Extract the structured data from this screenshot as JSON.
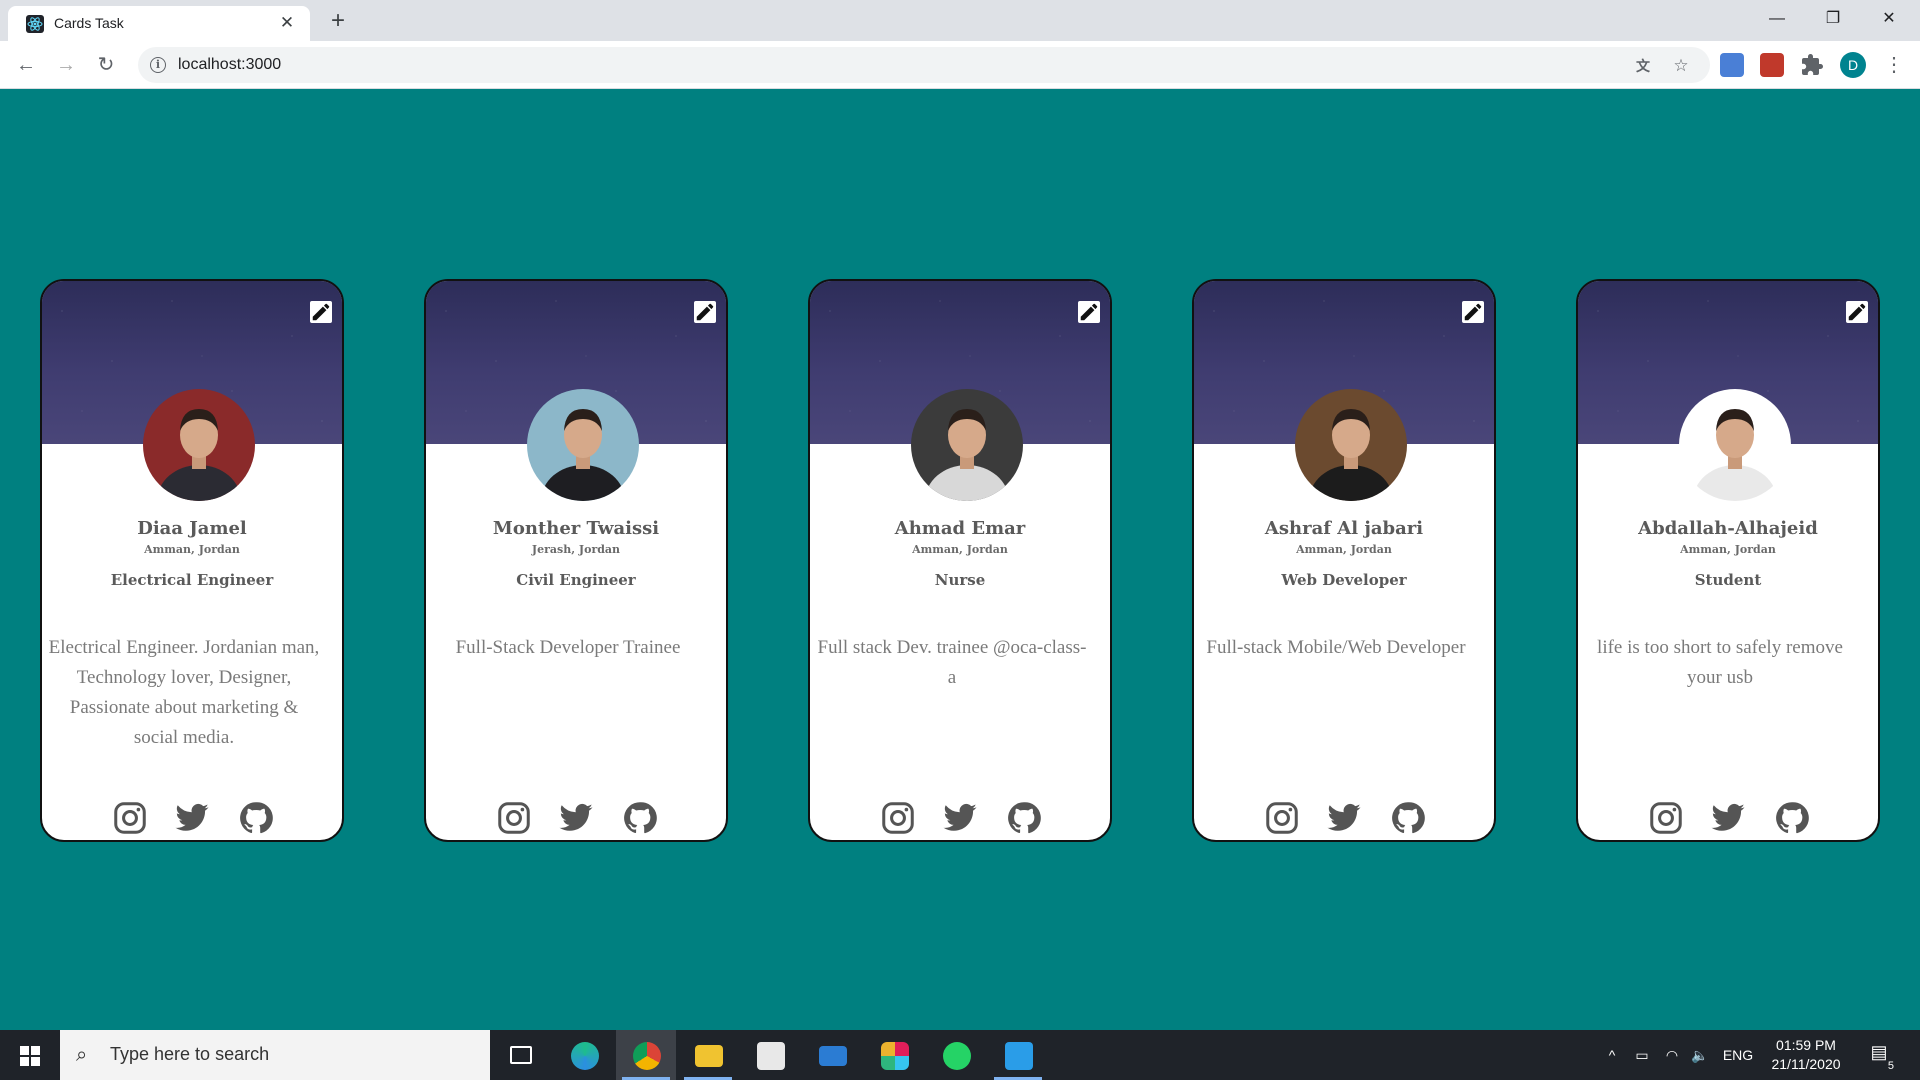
{
  "browser": {
    "tab_title": "Cards Task",
    "tab_close": "✕",
    "new_tab": "+",
    "url": "localhost:3000",
    "window_controls": {
      "minimize": "—",
      "maximize": "❐",
      "close": "✕"
    },
    "nav": {
      "back": "←",
      "forward": "→",
      "reload": "↻"
    },
    "profile_initial": "D",
    "menu": "⋮"
  },
  "cards": [
    {
      "name": "Diaa Jamel",
      "location": "Amman, Jordan",
      "job": "Electrical Engineer",
      "bio": "Electrical Engineer. Jordanian man, Technology lover, Designer, Passionate about marketing & social media.",
      "avatar_bg": "#8a2a2a",
      "avatar_shirt": "#2b2b33"
    },
    {
      "name": "Monther Twaissi",
      "location": "Jerash, Jordan",
      "job": "Civil Engineer",
      "bio": "Full-Stack Developer Trainee",
      "avatar_bg": "#8cb7c9",
      "avatar_shirt": "#1e1e22"
    },
    {
      "name": "Ahmad Emar",
      "location": "Amman, Jordan",
      "job": "Nurse",
      "bio": "Full stack Dev. trainee @oca-class-a",
      "avatar_bg": "#3b3b3b",
      "avatar_shirt": "#d8d8d8"
    },
    {
      "name": "Ashraf Al jabari",
      "location": "Amman, Jordan",
      "job": "Web Developer",
      "bio": "Full-stack Mobile/Web Developer",
      "avatar_bg": "#6b4a2f",
      "avatar_shirt": "#1c1c1c"
    },
    {
      "name": "Abdallah-Alhajeid",
      "location": "Amman, Jordan",
      "job": "Student",
      "bio": "life is too short to safely remove your usb",
      "avatar_bg": "#ffffff",
      "avatar_shirt": "#e9e9e9"
    }
  ],
  "social_icons": [
    "instagram-icon",
    "twitter-icon",
    "github-icon"
  ],
  "taskbar": {
    "search_placeholder": "Type here to search",
    "language": "ENG",
    "time": "01:59 PM",
    "date": "21/11/2020",
    "notification_count": "5"
  },
  "colors": {
    "page_background": "#008080",
    "card_border": "#111111",
    "text_gray": "#5a5a5a"
  }
}
